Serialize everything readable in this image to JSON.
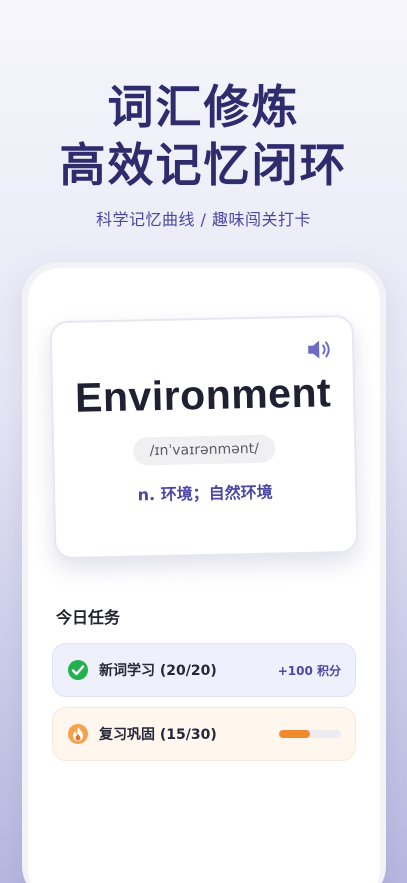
{
  "hero": {
    "line1": "词汇修炼",
    "line2": "高效记忆闭环",
    "subtitle": "科学记忆曲线 / 趣味闯关打卡"
  },
  "card": {
    "word": "Environment",
    "phonetic": "/ɪnˈvaɪrənmənt/",
    "meaning": "n. 环境；自然环境",
    "speaker_icon": "speaker-icon"
  },
  "tasks": {
    "title": "今日任务",
    "items": [
      {
        "label": "新词学习 (20/20)",
        "reward": "+100 积分",
        "icon": "check-circle-icon",
        "status_color": "#22b14c"
      },
      {
        "label": "复习巩固 (15/30)",
        "progress": 0.5,
        "icon": "flame-icon",
        "status_color": "#f08a2f"
      }
    ]
  },
  "colors": {
    "accent": "#4d48a8",
    "title": "#2f2c6e",
    "progress": "#f08a2f",
    "success": "#22b14c"
  }
}
